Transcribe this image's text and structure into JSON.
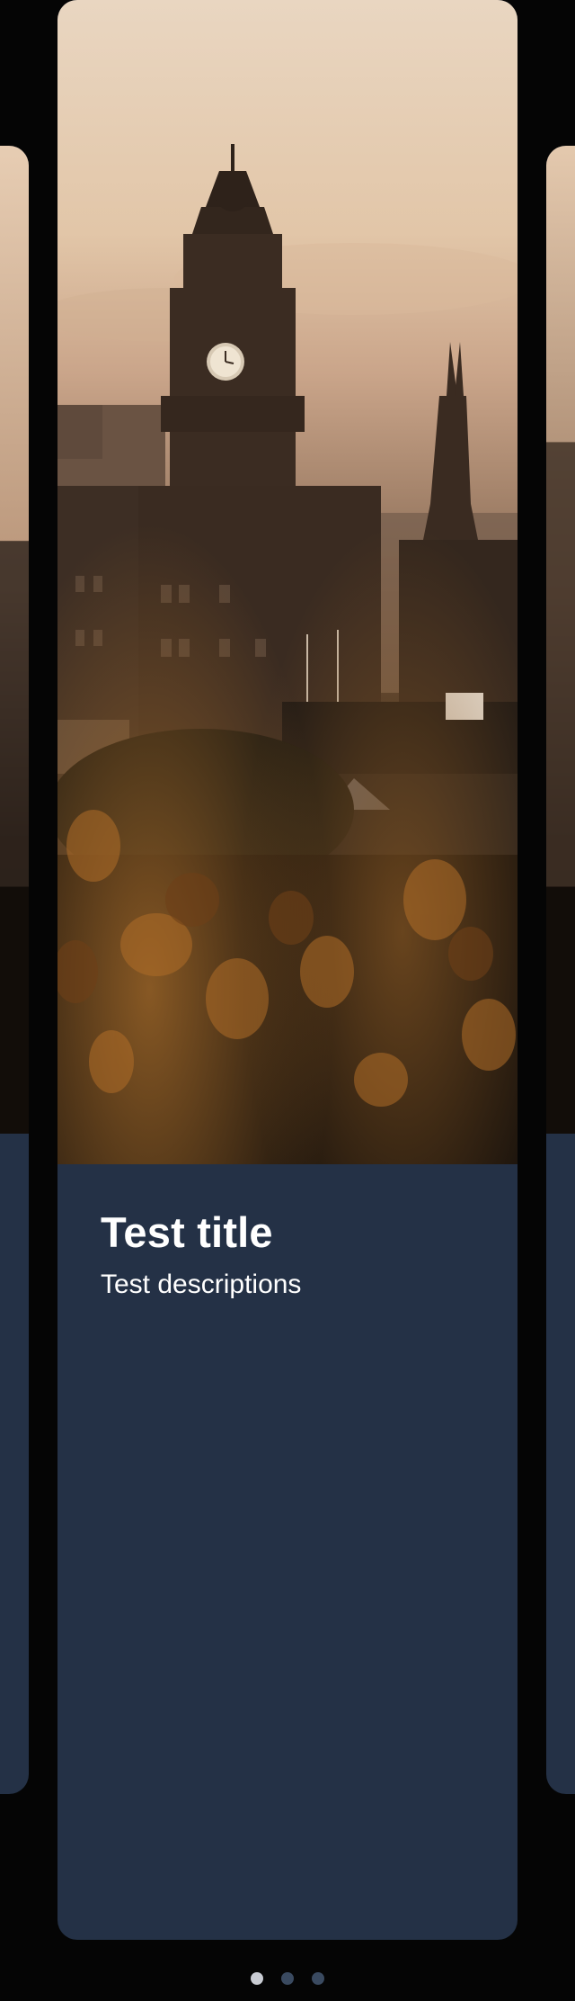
{
  "carousel": {
    "cards": [
      {
        "title": "Test title",
        "description": "Test descriptions",
        "image_alt": "city-skyline-photo"
      }
    ],
    "pagination": {
      "total": 3,
      "active_index": 0
    }
  },
  "colors": {
    "background": "#050505",
    "card": "#243146",
    "dot_active": "#c9ccd3",
    "dot_inactive": "#3a4a60"
  }
}
